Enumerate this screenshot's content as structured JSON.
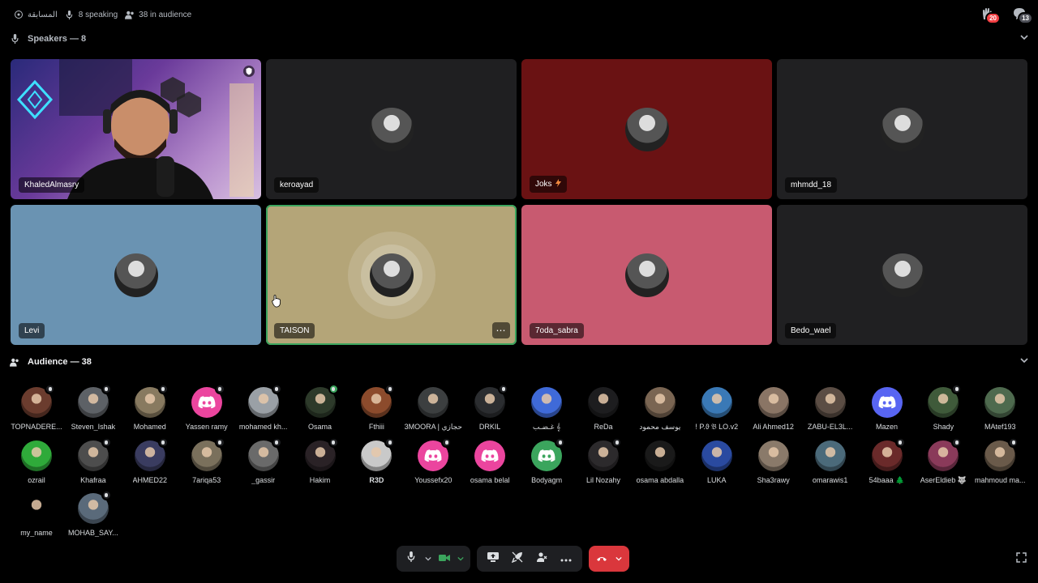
{
  "topbar": {
    "channel_name": "المسابقة",
    "speaking": "8 speaking",
    "audience": "38 in audience",
    "hands_badge": "20",
    "invites_badge": "13"
  },
  "speakers_header": "Speakers — 8",
  "audience_header": "Audience — 38",
  "speakers": [
    {
      "name": "KhaledAlmasry",
      "bg": "#2a1e5a",
      "video": true
    },
    {
      "name": "keroayad",
      "bg": "#1f1f21"
    },
    {
      "name": "Joks",
      "bg": "#6a1213",
      "suffix_icon": "lightning-icon"
    },
    {
      "name": "mhmdd_18",
      "bg": "#202022"
    },
    {
      "name": "Levi",
      "bg": "#6a93b2"
    },
    {
      "name": "TAISON",
      "bg": "#b4a578",
      "speaking": true
    },
    {
      "name": "7oda_sabra",
      "bg": "#c85a70"
    },
    {
      "name": "Bedo_wael",
      "bg": "#202022"
    }
  ],
  "audience_members": [
    {
      "name": "TOPNADERE...",
      "color": "#6b3c2e",
      "mute": true
    },
    {
      "name": "Steven_Ishak",
      "color": "#5d6166",
      "mute": true
    },
    {
      "name": "Mohamed",
      "color": "#887a60",
      "mute": true
    },
    {
      "name": "Yassen ramy",
      "color": "#eb459e",
      "discord": true,
      "mute": true
    },
    {
      "name": "mohamed kh...",
      "color": "#9aa0a6",
      "mute": true
    },
    {
      "name": "Osama",
      "color": "#2d3a2a",
      "mute": true,
      "green": true
    },
    {
      "name": "Fthiii",
      "color": "#8c4b2c",
      "mute": true
    },
    {
      "name": "3MOORA | حجازي",
      "color": "#3c3f40"
    },
    {
      "name": "DRKIL",
      "color": "#2b2d30",
      "mute": true
    },
    {
      "name": "غـضـب 𝄞",
      "color": "#3f6ad8"
    },
    {
      "name": "ReDa",
      "color": "#1d1d1f"
    },
    {
      "name": "يوسف محمود",
      "color": "#7a6552"
    },
    {
      "name": "! P.ϑ 𝔅 LO.v2",
      "color": "#3a79b6"
    },
    {
      "name": "Ali Ahmed12",
      "color": "#8a7565"
    },
    {
      "name": "ZABU-EL3L...",
      "color": "#5b4d44"
    },
    {
      "name": "Mazen",
      "color": "#5865f2",
      "discord": true
    },
    {
      "name": "Shady",
      "color": "#3f5a3a",
      "mute": true
    },
    {
      "name": "MAtef193",
      "color": "#4e6a4e"
    },
    {
      "name": "ozrail",
      "color": "#2faa3a"
    },
    {
      "name": "Khafraa",
      "color": "#4d4d4d",
      "mute": true
    },
    {
      "name": "AHMED22",
      "color": "#3a3c60",
      "mute": true
    },
    {
      "name": "7ariqa53",
      "color": "#7a705c",
      "mute": true
    },
    {
      "name": "_gassir",
      "color": "#6a6a6a",
      "mute": true
    },
    {
      "name": "Hakim",
      "color": "#2a2226",
      "mute": true
    },
    {
      "name": "R3D",
      "color": "#c9c9c9",
      "mute": true,
      "bold": true
    },
    {
      "name": "Youssefx20",
      "color": "#eb459e",
      "discord": true,
      "mute": true
    },
    {
      "name": "osama belal",
      "color": "#eb459e",
      "discord": true
    },
    {
      "name": "Bodyagm",
      "color": "#3ba55d",
      "discord": true,
      "mute": true
    },
    {
      "name": "Lil Nozahy",
      "color": "#2c2a2c",
      "mute": true
    },
    {
      "name": "osama abdalla",
      "color": "#1a1a1a"
    },
    {
      "name": "LUKA",
      "color": "#2a4aa0"
    },
    {
      "name": "Sha3rawy",
      "color": "#8a7a6a"
    },
    {
      "name": "omarawis1",
      "color": "#4b6a7a"
    },
    {
      "name": "54baaa 🌲",
      "color": "#6a2a2a",
      "mute": true
    },
    {
      "name": "AserEldieb 🐺",
      "color": "#8a3a5a",
      "mute": true
    },
    {
      "name": "mahmoud ma...",
      "color": "#6a5a4a",
      "mute": true
    },
    {
      "name": "my_name",
      "color": "#000000"
    },
    {
      "name": "MOHAB_SAY...",
      "color": "#5a6a7a",
      "mute": true
    }
  ],
  "colors": {
    "hangup": "#da373c",
    "speaking_ring": "#3ba55d",
    "discord_blurple": "#5865f2"
  }
}
